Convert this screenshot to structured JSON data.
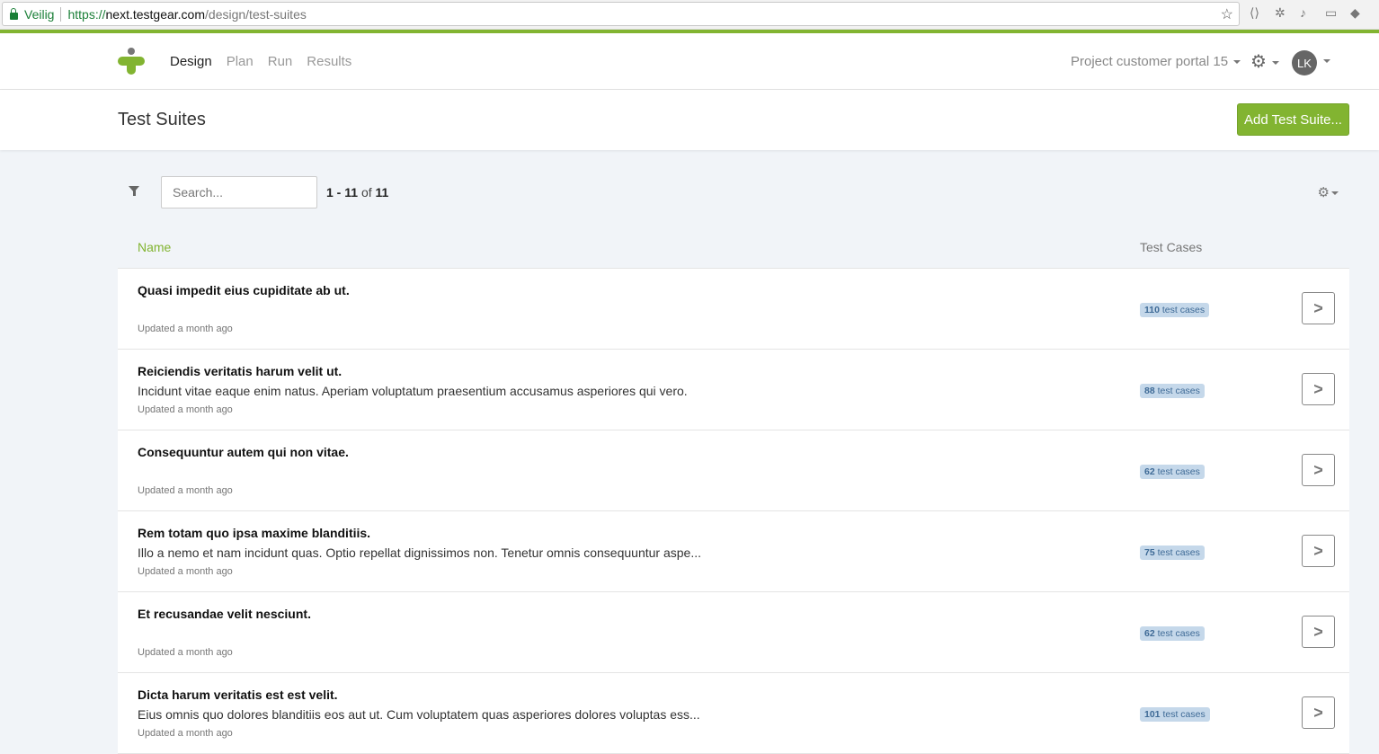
{
  "browser": {
    "secure_label": "Veilig",
    "url_scheme": "https://",
    "url_host": "next.testgear.com",
    "url_path": "/design/test-suites"
  },
  "nav": {
    "links": [
      "Design",
      "Plan",
      "Run",
      "Results"
    ],
    "project": "Project customer portal 15",
    "avatar_initials": "LK"
  },
  "page": {
    "title": "Test Suites",
    "add_button": "Add Test Suite..."
  },
  "toolbar": {
    "search_placeholder": "Search...",
    "range_start": "1",
    "range_end": "11",
    "range_of": "of",
    "total": "11"
  },
  "columns": {
    "name": "Name",
    "test_cases": "Test Cases"
  },
  "colors": {
    "accent": "#82b431",
    "badge_bg": "#c5d8ea",
    "badge_text": "#3e6a96"
  },
  "suites": [
    {
      "title": "Quasi impedit eius cupiditate ab ut.",
      "description": "",
      "updated": "Updated a month ago",
      "count": "110",
      "count_label": "test cases"
    },
    {
      "title": "Reiciendis veritatis harum velit ut.",
      "description": "Incidunt vitae eaque enim natus. Aperiam voluptatum praesentium accusamus asperiores qui vero.",
      "updated": "Updated a month ago",
      "count": "88",
      "count_label": "test cases"
    },
    {
      "title": "Consequuntur autem qui non vitae.",
      "description": "",
      "updated": "Updated a month ago",
      "count": "62",
      "count_label": "test cases"
    },
    {
      "title": "Rem totam quo ipsa maxime blanditiis.",
      "description": "Illo a nemo et nam incidunt quas. Optio repellat dignissimos non. Tenetur omnis consequuntur aspe...",
      "updated": "Updated a month ago",
      "count": "75",
      "count_label": "test cases"
    },
    {
      "title": "Et recusandae velit nesciunt.",
      "description": "",
      "updated": "Updated a month ago",
      "count": "62",
      "count_label": "test cases"
    },
    {
      "title": "Dicta harum veritatis est est velit.",
      "description": "Eius omnis quo dolores blanditiis eos aut ut. Cum voluptatem quas asperiores dolores voluptas ess...",
      "updated": "Updated a month ago",
      "count": "101",
      "count_label": "test cases"
    }
  ]
}
